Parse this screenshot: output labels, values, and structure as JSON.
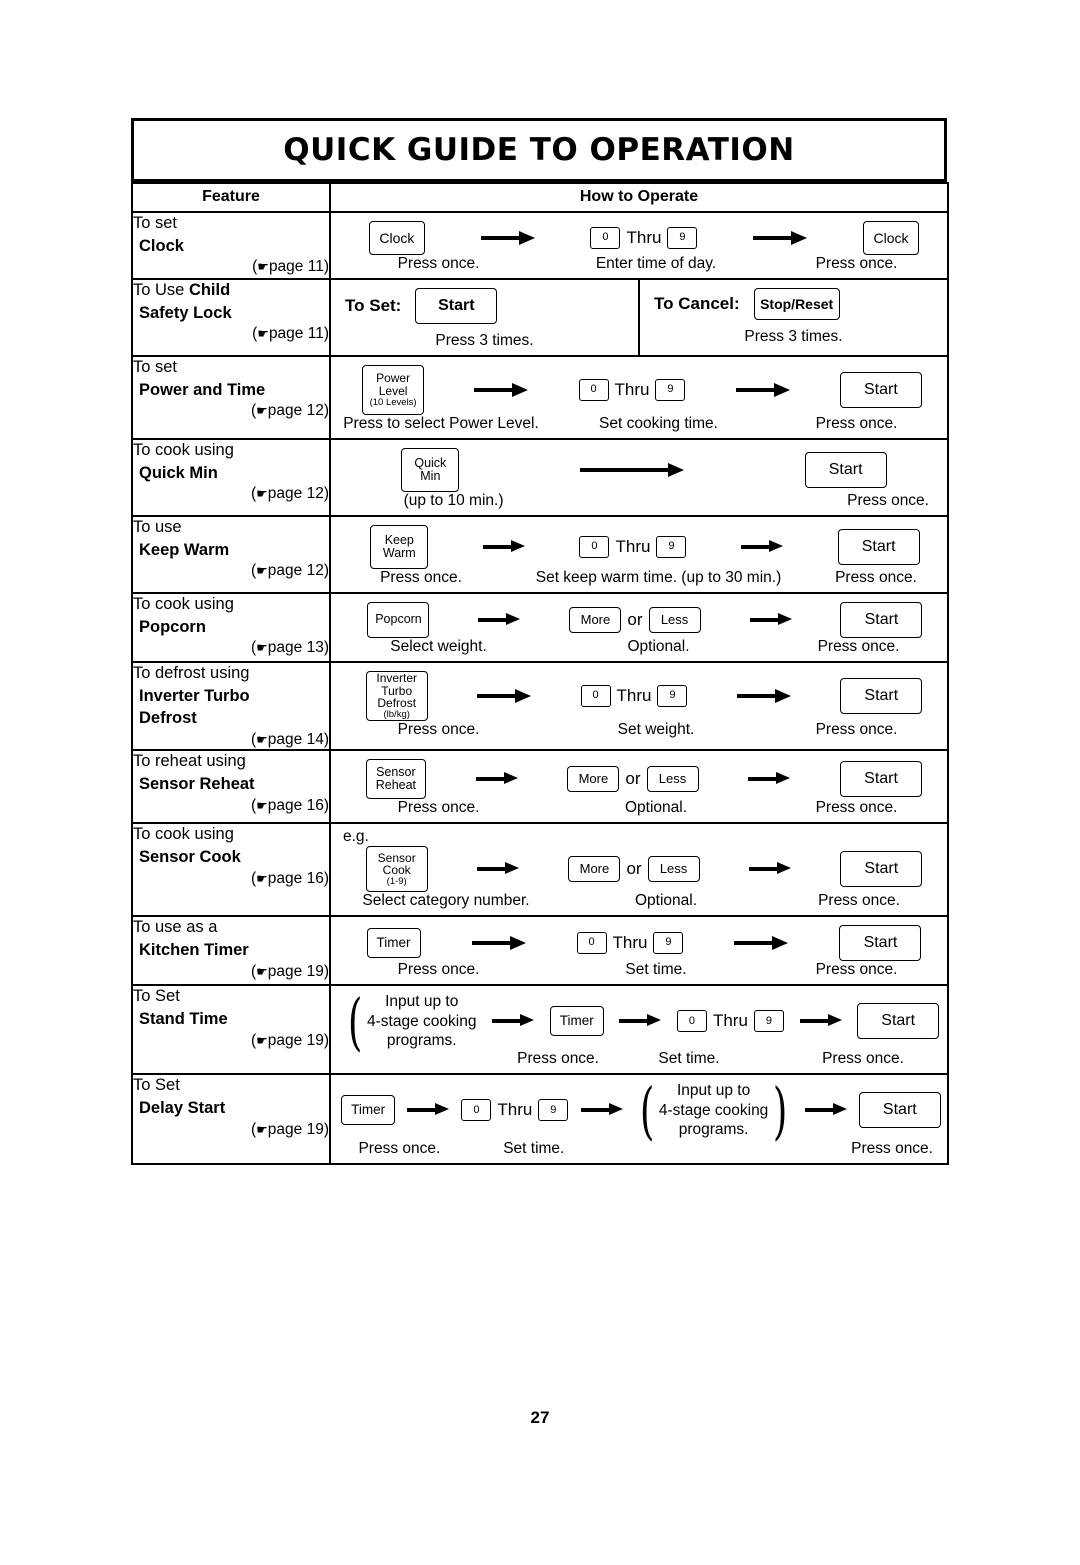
{
  "title": "QUICK GUIDE TO OPERATION",
  "headers": {
    "feature": "Feature",
    "how": "How to Operate"
  },
  "page_number": "27",
  "labels": {
    "thru": "Thru",
    "or": "or",
    "press_once": "Press once.",
    "press_3_times": "Press 3 times.",
    "optional": "Optional.",
    "set_time": "Set time.",
    "eg": "e.g.",
    "to_set": "To Set:",
    "to_cancel": "To Cancel:",
    "num_0": "0",
    "num_9": "9"
  },
  "buttons": {
    "clock": "Clock",
    "start": "Start",
    "stop_reset": "Stop/Reset",
    "power_level": "Power Level",
    "power_level_sub": "(10 Levels)",
    "quick_min": "Quick Min",
    "keep_warm": "Keep Warm",
    "popcorn": "Popcorn",
    "more": "More",
    "less": "Less",
    "inverter_turbo_defrost": "Inverter Turbo Defrost",
    "inverter_sub": "(lb/kg)",
    "sensor_reheat": "Sensor Reheat",
    "sensor_cook": "Sensor Cook",
    "sensor_cook_sub": "(1-9)",
    "timer": "Timer"
  },
  "rows": [
    {
      "feature_line1": "To set",
      "feature_bold": "Clock",
      "page": "page 11",
      "captions": [
        "Press once.",
        "Enter time of day.",
        "Press once."
      ]
    },
    {
      "feature_line1_pre": "To Use ",
      "feature_line1_bold": "Child",
      "feature_bold": "Safety Lock",
      "page": "page 11",
      "to_set": "To Set:",
      "to_cancel": "To Cancel:",
      "captions": [
        "Press 3 times.",
        "Press 3 times."
      ]
    },
    {
      "feature_line1": "To set",
      "feature_bold": "Power and Time",
      "page": "page 12",
      "captions": [
        "Press to select Power Level.",
        "Set cooking time.",
        "Press once."
      ]
    },
    {
      "feature_line1": "To cook using",
      "feature_bold": "Quick Min",
      "page": "page 12",
      "captions": [
        "(up to 10 min.)",
        "Press once."
      ]
    },
    {
      "feature_line1": "To use",
      "feature_bold": "Keep Warm",
      "page": "page 12",
      "captions": [
        "Press once.",
        "Set keep warm time. (up to 30 min.)",
        "Press once."
      ]
    },
    {
      "feature_line1": "To cook using",
      "feature_bold": "Popcorn",
      "page": "page 13",
      "captions": [
        "Select weight.",
        "Optional.",
        "Press once."
      ]
    },
    {
      "feature_line1": "To defrost using",
      "feature_bold": "Inverter Turbo",
      "feature_bold2": "Defrost",
      "page": "page 14",
      "captions": [
        "Press once.",
        "Set weight.",
        "Press once."
      ]
    },
    {
      "feature_line1": "To reheat using",
      "feature_bold": "Sensor Reheat",
      "page": "page 16",
      "captions": [
        "Press once.",
        "Optional.",
        "Press once."
      ]
    },
    {
      "feature_line1": "To cook using",
      "feature_bold": "Sensor Cook",
      "page": "page 16",
      "captions": [
        "Select category number.",
        "Optional.",
        "Press once."
      ]
    },
    {
      "feature_line1": "To use as a",
      "feature_bold": "Kitchen Timer",
      "page": "page 19",
      "captions": [
        "Press once.",
        "Set time.",
        "Press once."
      ]
    },
    {
      "feature_line1": "To Set",
      "feature_bold": "Stand Time",
      "page": "page 19",
      "brace_text": "Input up to 4-stage cooking programs.",
      "captions": [
        "Press once.",
        "Set time.",
        "Press once."
      ]
    },
    {
      "feature_line1": "To Set",
      "feature_bold": "Delay Start",
      "page": "page 19",
      "brace_text": "Input up to 4-stage cooking programs.",
      "captions": [
        "Press once.",
        "Set time.",
        "Press once."
      ]
    }
  ]
}
